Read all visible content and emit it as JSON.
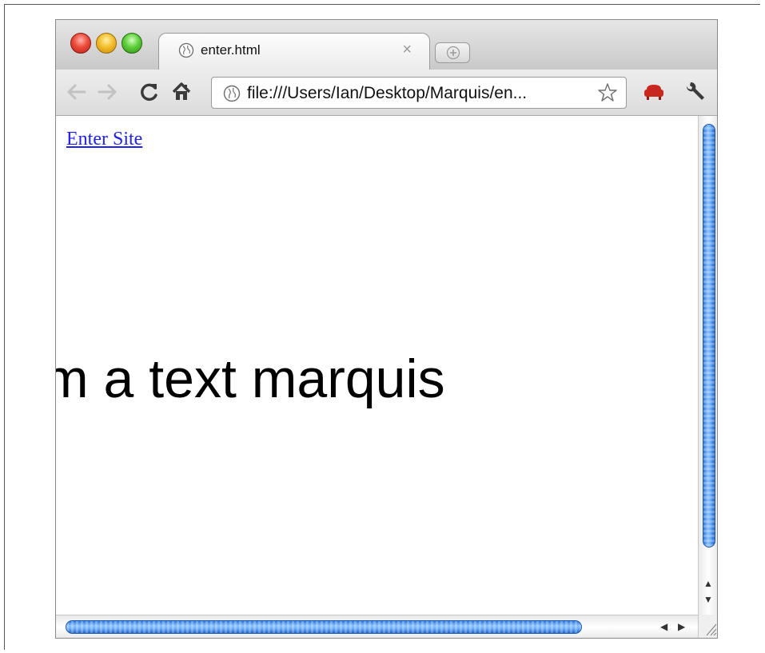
{
  "window": {
    "tab_title": "enter.html",
    "tab_close_glyph": "×",
    "url": "file:///Users/Ian/Desktop/Marquis/en...",
    "icons": {
      "back": "back-arrow-icon",
      "forward": "forward-arrow-icon",
      "reload": "reload-icon",
      "home": "home-icon",
      "page": "globe-icon",
      "bookmark": "star-icon",
      "extension": "sofa-extension-icon",
      "menu": "wrench-icon"
    }
  },
  "content": {
    "link_label": "Enter Site",
    "marquee_text": "m a text marquis"
  },
  "scrollbars": {
    "up": "▲",
    "down": "▼",
    "left": "◀",
    "right": "▶"
  },
  "colors": {
    "link": "#1f1fee",
    "scroll_thumb": "#5aa0f5",
    "close_red": "#ec4b3c",
    "minimize_yellow": "#f4be2c",
    "zoom_green": "#5fcf3b",
    "extension_red": "#c8281e"
  }
}
